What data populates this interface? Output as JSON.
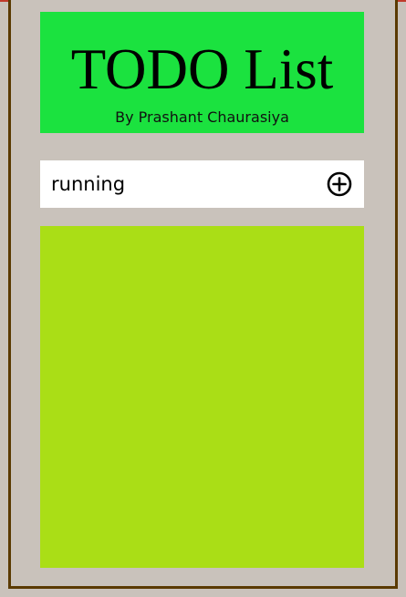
{
  "header": {
    "title": "TODO List",
    "subtitle": "By Prashant Chaurasiya"
  },
  "input": {
    "value": "running",
    "add_icon": "plus-circle-icon"
  },
  "list": {
    "items": []
  },
  "colors": {
    "page_background": "#c9c2bb",
    "frame_border": "#5a3a00",
    "header_background": "#1be23f",
    "input_background": "#ffffff",
    "list_background": "#aade16",
    "top_strip": "#c0392b"
  }
}
